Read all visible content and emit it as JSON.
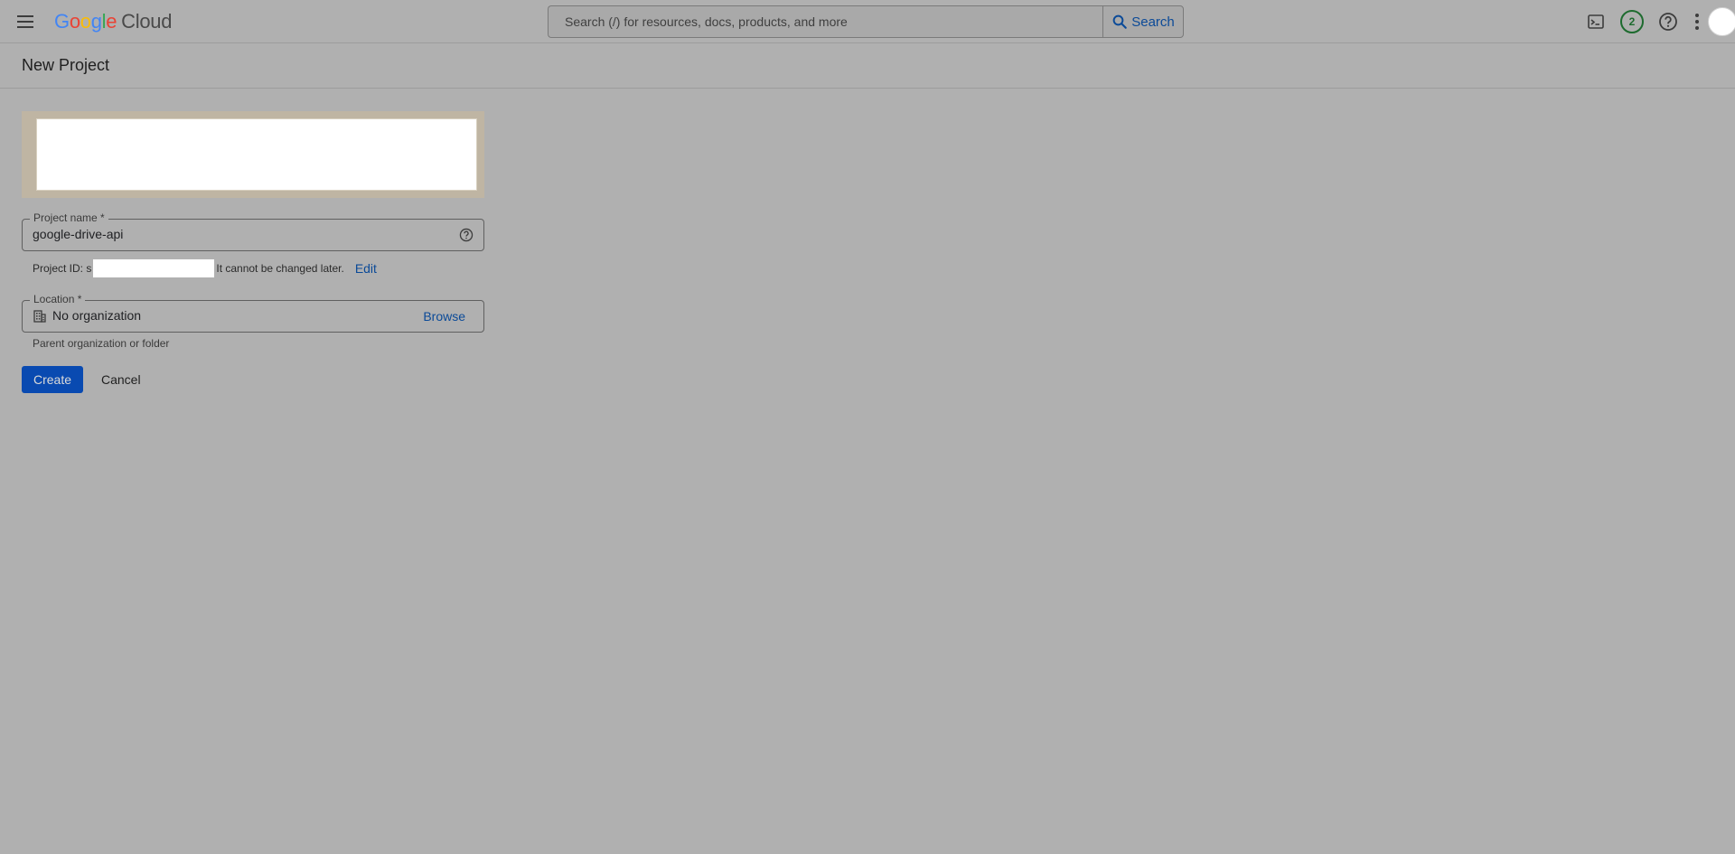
{
  "header": {
    "logo_google": "Google",
    "logo_cloud": "Cloud",
    "search_placeholder": "Search (/) for resources, docs, products, and more",
    "search_button_label": "Search",
    "notifications_count": "2"
  },
  "page": {
    "title": "New Project"
  },
  "form": {
    "project_name_label": "Project name *",
    "project_name_value": "google-drive-api",
    "project_id_prefix": "Project ID: s",
    "project_id_suffix": "It cannot be changed later.",
    "edit_label": "Edit",
    "location_label": "Location *",
    "location_value": "No organization",
    "browse_label": "Browse",
    "location_helper": "Parent organization or folder",
    "create_label": "Create",
    "cancel_label": "Cancel"
  },
  "colors": {
    "google_blue": "#4285F4",
    "google_red": "#EA4335",
    "google_yellow": "#FBBC05",
    "google_green": "#34A853",
    "link_blue": "#0b4a98",
    "primary_button": "#0b57d0",
    "badge_green": "#1e6b2f"
  },
  "icons": {
    "menu": "hamburger-menu-icon",
    "search": "search-icon",
    "terminal": "cloud-shell-terminal-icon",
    "help": "help-circle-icon",
    "more": "more-vert-icon",
    "building": "building-icon"
  }
}
